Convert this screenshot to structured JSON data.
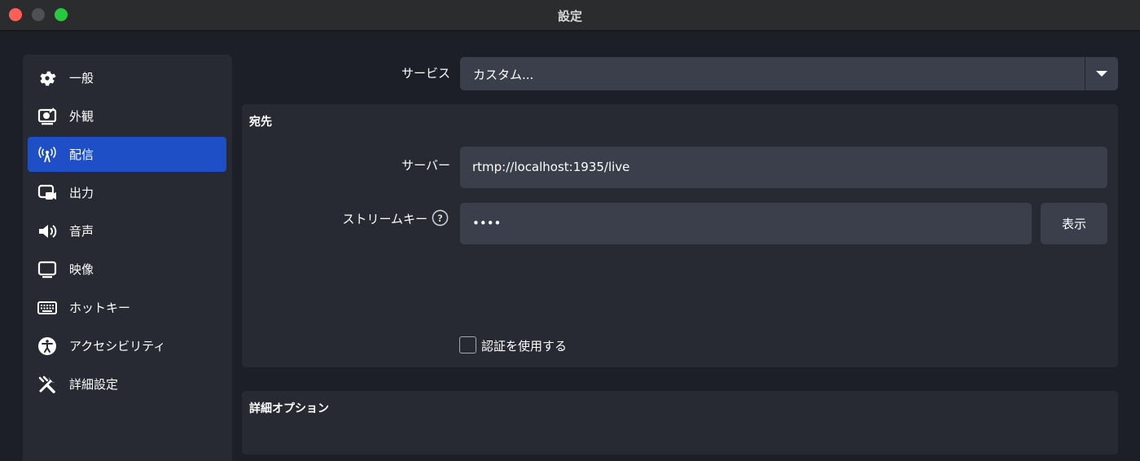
{
  "window": {
    "title": "設定"
  },
  "sidebar": {
    "items": [
      {
        "label": "一般",
        "icon": "gear-icon"
      },
      {
        "label": "外観",
        "icon": "appearance-icon"
      },
      {
        "label": "配信",
        "icon": "broadcast-antenna-icon",
        "active": true
      },
      {
        "label": "出力",
        "icon": "output-camera-icon"
      },
      {
        "label": "音声",
        "icon": "speaker-icon"
      },
      {
        "label": "映像",
        "icon": "monitor-icon"
      },
      {
        "label": "ホットキー",
        "icon": "keyboard-icon"
      },
      {
        "label": "アクセシビリティ",
        "icon": "accessibility-icon"
      },
      {
        "label": "詳細設定",
        "icon": "tools-icon"
      }
    ]
  },
  "service": {
    "label": "サービス",
    "value": "カスタム..."
  },
  "destination": {
    "title": "宛先",
    "server_label": "サーバー",
    "server_value": "rtmp://localhost:1935/live",
    "stream_key_label": "ストリームキー",
    "stream_key_value": "••••",
    "show_button": "表示",
    "auth_label": "認証を使用する",
    "auth_checked": false
  },
  "advanced": {
    "title": "詳細オプション"
  },
  "colors": {
    "accent": "#1f4fc7",
    "background": "#1d1f28",
    "panel": "#272a33",
    "field": "#3b3f4c"
  }
}
